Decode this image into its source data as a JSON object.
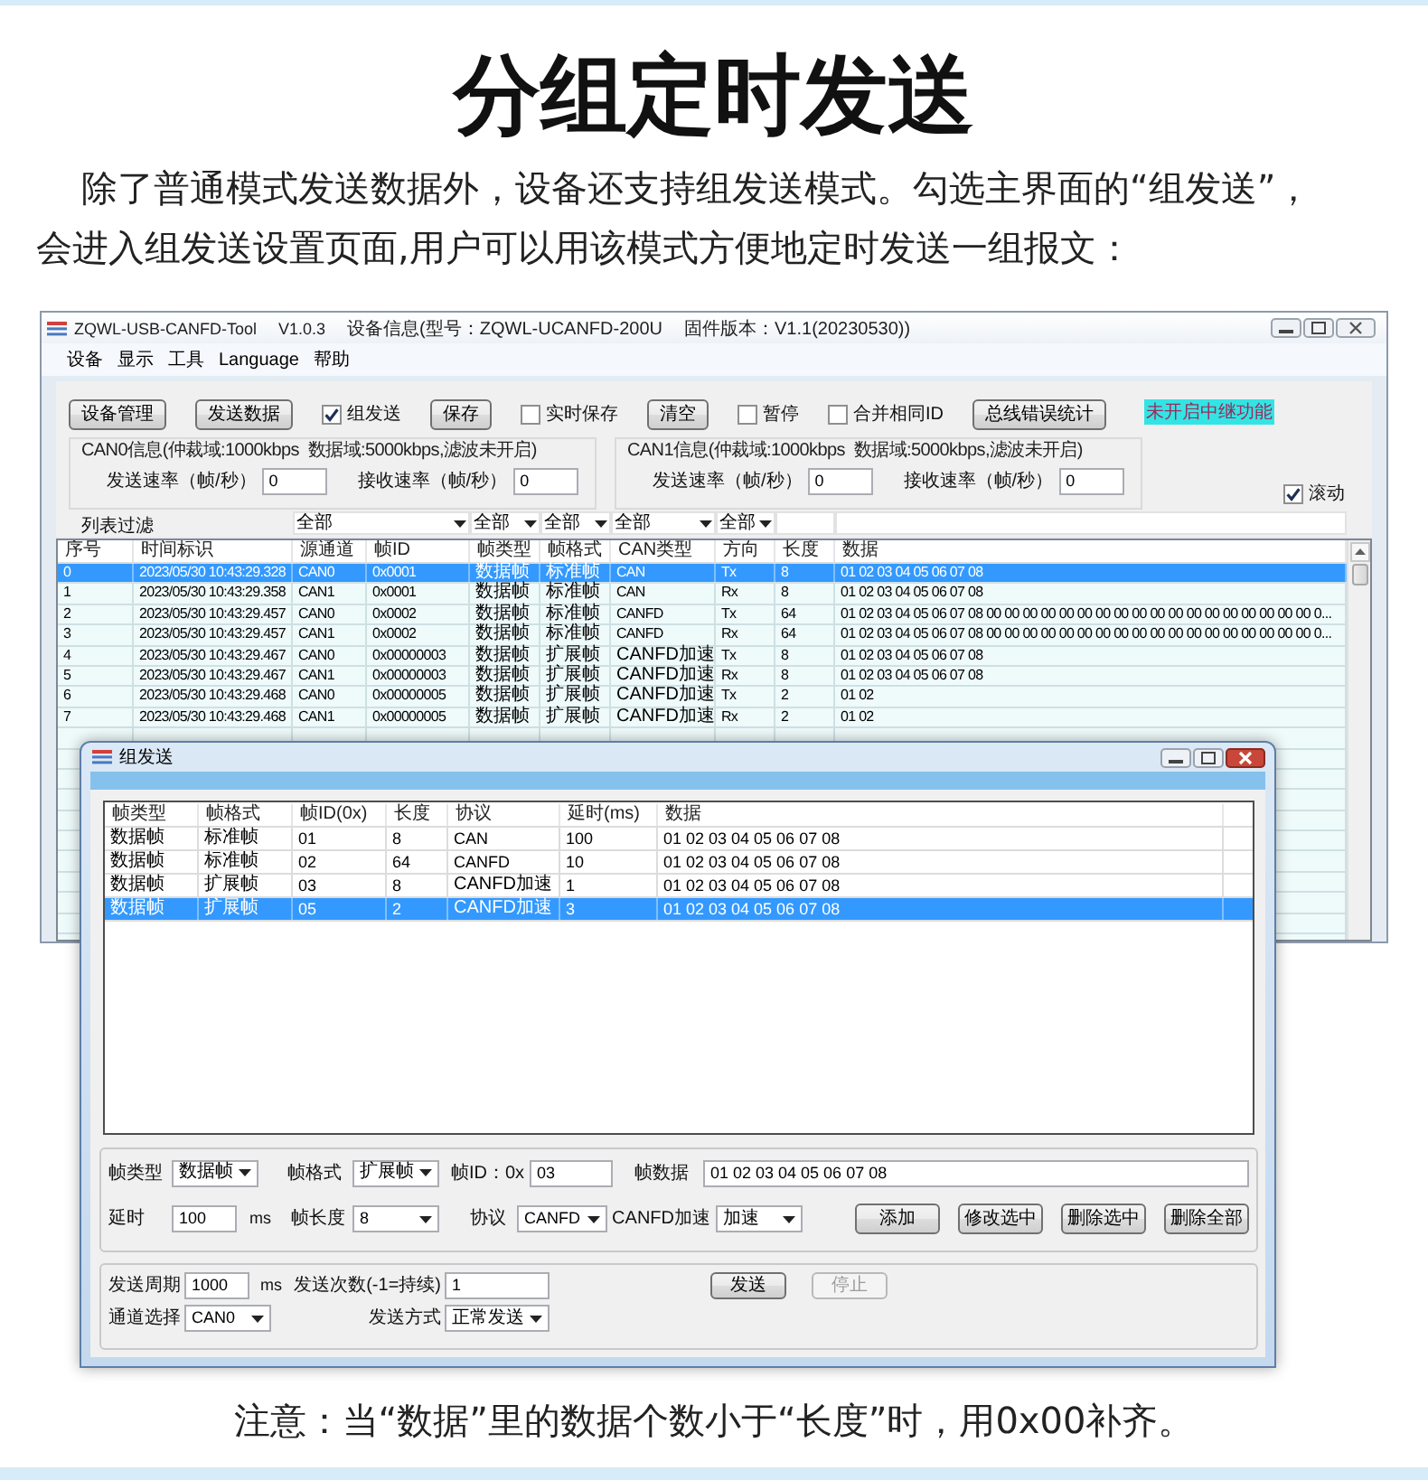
{
  "heading": "分组定时发送",
  "intro": "除了普通模式发送数据外，设备还支持组发送模式。勾选主界面的“组发送”，会进入组发送设置页面,用户可以用该模式方便地定时发送一组报文：",
  "main_window": {
    "title": {
      "app": "ZQWL-USB-CANFD-Tool",
      "version": "V1.0.3",
      "device_info": "设备信息(型号：ZQWL-UCANFD-200U",
      "firmware": "固件版本：V1.1(20230530))"
    },
    "menu": [
      "设备",
      "显示",
      "工具",
      "Language",
      "帮助"
    ],
    "toolbar": [
      {
        "kind": "button",
        "label": "设备管理"
      },
      {
        "kind": "button",
        "label": "发送数据"
      },
      {
        "kind": "checkbox",
        "label": "组发送",
        "checked": true
      },
      {
        "kind": "button",
        "label": "保存"
      },
      {
        "kind": "checkbox",
        "label": "实时保存",
        "checked": false
      },
      {
        "kind": "button",
        "label": "清空"
      },
      {
        "kind": "checkbox",
        "label": "暂停",
        "checked": false
      },
      {
        "kind": "checkbox",
        "label": "合并相同ID",
        "checked": false
      },
      {
        "kind": "button",
        "label": "总线错误统计"
      }
    ],
    "relay_status": "未开启中继功能",
    "channels": [
      {
        "info": "CAN0信息(仲裁域:1000kbps  数据域:5000kbps,滤波未开启)",
        "tx_rate_label": "发送速率（帧/秒）",
        "tx_rate": "0",
        "rx_rate_label": "接收速率（帧/秒）",
        "rx_rate": "0"
      },
      {
        "info": "CAN1信息(仲裁域:1000kbps  数据域:5000kbps,滤波未开启)",
        "tx_rate_label": "发送速率（帧/秒）",
        "tx_rate": "0",
        "rx_rate_label": "接收速率（帧/秒）",
        "rx_rate": "0"
      }
    ],
    "auto_scroll": {
      "label": "滚动",
      "checked": true
    },
    "filter": {
      "label": "列表过滤",
      "values": [
        "全部",
        "全部",
        "全部",
        "全部",
        "全部"
      ]
    },
    "table": {
      "columns": [
        "序号",
        "时间标识",
        "源通道",
        "帧ID",
        "帧类型",
        "帧格式",
        "CAN类型",
        "方向",
        "长度",
        "数据"
      ],
      "rows": [
        {
          "selected": true,
          "cells": [
            "0",
            "2023/05/30 10:43:29.328",
            "CAN0",
            "0x0001",
            "数据帧",
            "标准帧",
            "CAN",
            "Tx",
            "8",
            "01 02 03 04 05 06 07 08"
          ]
        },
        {
          "selected": false,
          "cells": [
            "1",
            "2023/05/30 10:43:29.358",
            "CAN1",
            "0x0001",
            "数据帧",
            "标准帧",
            "CAN",
            "Rx",
            "8",
            "01 02 03 04 05 06 07 08"
          ]
        },
        {
          "selected": false,
          "cells": [
            "2",
            "2023/05/30 10:43:29.457",
            "CAN0",
            "0x0002",
            "数据帧",
            "标准帧",
            "CANFD",
            "Tx",
            "64",
            "01 02 03 04 05 06 07 08 00 00 00 00 00 00 00 00 00 00 00 00 00 00 00 00 00 00 0..."
          ]
        },
        {
          "selected": false,
          "cells": [
            "3",
            "2023/05/30 10:43:29.457",
            "CAN1",
            "0x0002",
            "数据帧",
            "标准帧",
            "CANFD",
            "Rx",
            "64",
            "01 02 03 04 05 06 07 08 00 00 00 00 00 00 00 00 00 00 00 00 00 00 00 00 00 00 0..."
          ]
        },
        {
          "selected": false,
          "cells": [
            "4",
            "2023/05/30 10:43:29.467",
            "CAN0",
            "0x00000003",
            "数据帧",
            "扩展帧",
            "CANFD加速",
            "Tx",
            "8",
            "01 02 03 04 05 06 07 08"
          ]
        },
        {
          "selected": false,
          "cells": [
            "5",
            "2023/05/30 10:43:29.467",
            "CAN1",
            "0x00000003",
            "数据帧",
            "扩展帧",
            "CANFD加速",
            "Rx",
            "8",
            "01 02 03 04 05 06 07 08"
          ]
        },
        {
          "selected": false,
          "cells": [
            "6",
            "2023/05/30 10:43:29.468",
            "CAN0",
            "0x00000005",
            "数据帧",
            "扩展帧",
            "CANFD加速",
            "Tx",
            "2",
            "01 02"
          ]
        },
        {
          "selected": false,
          "cells": [
            "7",
            "2023/05/30 10:43:29.468",
            "CAN1",
            "0x00000005",
            "数据帧",
            "扩展帧",
            "CANFD加速",
            "Rx",
            "2",
            "01 02"
          ]
        }
      ]
    }
  },
  "dialog": {
    "title": "组发送",
    "table": {
      "columns": [
        "帧类型",
        "帧格式",
        "帧ID(0x)",
        "长度",
        "协议",
        "延时(ms)",
        "数据"
      ],
      "rows": [
        {
          "selected": false,
          "cells": [
            "数据帧",
            "标准帧",
            "01",
            "8",
            "CAN",
            "100",
            "01 02 03 04 05 06 07 08"
          ]
        },
        {
          "selected": false,
          "cells": [
            "数据帧",
            "标准帧",
            "02",
            "64",
            "CANFD",
            "10",
            "01 02 03 04 05 06 07 08"
          ]
        },
        {
          "selected": false,
          "cells": [
            "数据帧",
            "扩展帧",
            "03",
            "8",
            "CANFD加速",
            "1",
            "01 02 03 04 05 06 07 08"
          ]
        },
        {
          "selected": true,
          "cells": [
            "数据帧",
            "扩展帧",
            "05",
            "2",
            "CANFD加速",
            "3",
            "01 02 03 04 05 06 07 08"
          ]
        }
      ]
    },
    "frame_settings": {
      "frame_type": {
        "label": "帧类型",
        "value": "数据帧"
      },
      "frame_format": {
        "label": "帧格式",
        "value": "扩展帧"
      },
      "frame_id": {
        "label": "帧ID：0x",
        "value": "03"
      },
      "frame_data": {
        "label": "帧数据",
        "value": "01 02 03 04 05 06 07 08"
      },
      "delay": {
        "label": "延时",
        "value": "100",
        "unit": "ms"
      },
      "frame_length": {
        "label": "帧长度",
        "value": "8"
      },
      "protocol": {
        "label": "协议",
        "value": "CANFD"
      },
      "canfd_speedup": {
        "label": "CANFD加速",
        "value": "加速"
      },
      "buttons": [
        "添加",
        "修改选中",
        "删除选中",
        "删除全部"
      ]
    },
    "send_settings": {
      "period": {
        "label": "发送周期",
        "value": "1000",
        "unit": "ms"
      },
      "count": {
        "label": "发送次数(-1=持续)",
        "value": "1"
      },
      "channel": {
        "label": "通道选择",
        "value": "CAN0"
      },
      "mode": {
        "label": "发送方式",
        "value": "正常发送"
      },
      "buttons": [
        {
          "label": "发送",
          "disabled": false
        },
        {
          "label": "停止",
          "disabled": true
        }
      ]
    }
  },
  "note": "注意：当“数据”里的数据个数小于“长度”时，用0x00补齐。"
}
